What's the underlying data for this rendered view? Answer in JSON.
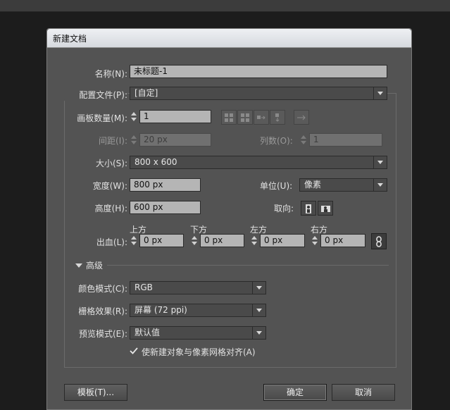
{
  "window": {
    "title": "新建文档"
  },
  "fields": {
    "name_label": "名称(N):",
    "name_value": "未标题-1",
    "profile_label": "配置文件(P):",
    "profile_value": "[自定]",
    "artboards_label": "画板数量(M):",
    "artboards_value": "1",
    "spacing_label": "间距(I):",
    "spacing_value": "20 px",
    "columns_label": "列数(O):",
    "columns_value": "1",
    "size_label": "大小(S):",
    "size_value": "800 x 600",
    "width_label": "宽度(W):",
    "width_value": "800 px",
    "units_label": "单位(U):",
    "units_value": "像素",
    "height_label": "高度(H):",
    "height_value": "600 px",
    "orientation_label": "取向:"
  },
  "bleed": {
    "label": "出血(L):",
    "top_label": "上方",
    "top_value": "0 px",
    "bottom_label": "下方",
    "bottom_value": "0 px",
    "left_label": "左方",
    "left_value": "0 px",
    "right_label": "右方",
    "right_value": "0 px"
  },
  "advanced": {
    "title": "高级",
    "color_mode_label": "颜色模式(C):",
    "color_mode_value": "RGB",
    "raster_label": "栅格效果(R):",
    "raster_value": "屏幕 (72 ppi)",
    "preview_label": "预览模式(E):",
    "preview_value": "默认值",
    "align_pixel_label": "使新建对象与像素网格对齐(A)",
    "align_pixel_checked": true
  },
  "buttons": {
    "templates": "模板(T)...",
    "ok": "确定",
    "cancel": "取消"
  },
  "icons": [
    "grid-by-row-icon",
    "grid-by-column-icon",
    "arrange-by-row-icon",
    "arrange-by-column-icon",
    "right-to-left-icon",
    "portrait-icon",
    "landscape-icon",
    "link-icon",
    "triangle-down-icon"
  ]
}
